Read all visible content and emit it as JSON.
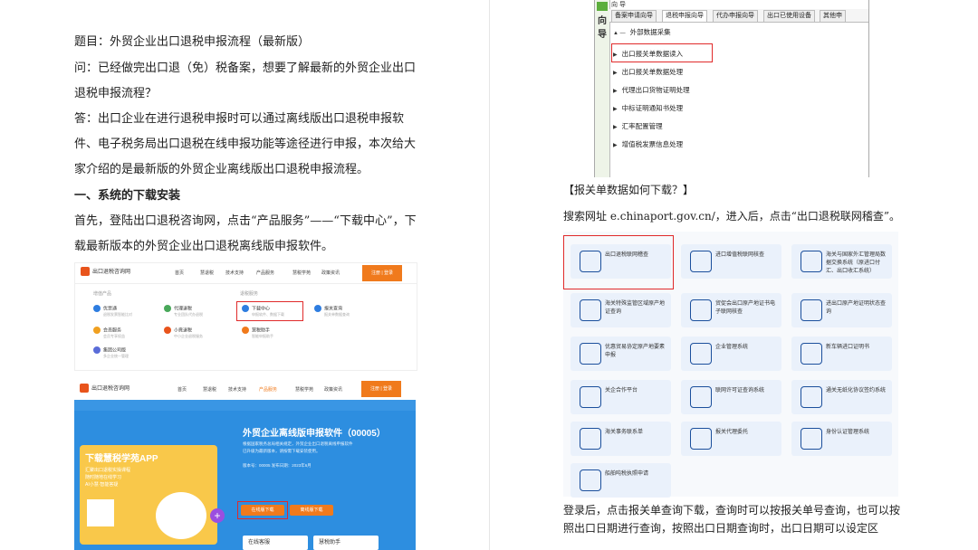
{
  "left": {
    "title": "题目：外贸企业出口退税申报流程（最新版）",
    "question": "问：已经做完出口退（免）税备案，想要了解最新的外贸企业出口退税申报流程？",
    "answer": "答：出口企业在进行退税申报时可以通过离线版出口退税申报软件、电子税务局出口退税在线申报功能等途径进行申报，本次给大家介绍的是最新版的外贸企业离线版出口退税申报流程。",
    "section_heading": "一、系统的下载安装",
    "install_text": "首先，登陆出口退税咨询网，点击“产品服务”——“下载中心”，下载最新版本的外贸企业出口退税离线版申报软件。",
    "site": {
      "logo": "出口退税咨询网",
      "nav": [
        "首页",
        "慧退税",
        "技术支持",
        "产品服务",
        "慧税学苑",
        "政策资讯"
      ],
      "nav_button": "注册 | 登录",
      "groups": [
        "增值产品",
        "退税服务"
      ],
      "items": [
        {
          "label": "优票通",
          "sub": "退税发票智能比对"
        },
        {
          "label": "代理退税",
          "sub": "专业团队代办退税"
        },
        {
          "label": "下载中心",
          "sub": "申报软件、数据下载"
        },
        {
          "label": "报关查询",
          "sub": "报关单数据查询"
        },
        {
          "label": "会员服务",
          "sub": "会员专享权益"
        },
        {
          "label": "小竟退税",
          "sub": "中小企业退税服务"
        },
        {
          "label": "慧税助手",
          "sub": "智能申报助手"
        },
        {
          "label": "集团公司版",
          "sub": "多企业统一管理"
        }
      ],
      "download_page": {
        "software_title": "外贸企业离线版申报软件（00005）",
        "desc_line1": "根据国家税务总局相关规定，外贸企业出口退税离线申报软件",
        "desc_line2": "已升级为最新版本，请按需下载安装使用。",
        "version": "版本号：00005    发布日期：2023年6月",
        "btn_online": "在线版下载",
        "btn_offline": "离线版下载",
        "promo_title": "下载慧税学苑APP",
        "promo_lines": [
          "汇聚出口退税实操课程",
          "随时随地在线学习",
          "AI小慧·智能答疑"
        ],
        "cards": [
          "在线客服",
          "慧税助手"
        ]
      }
    }
  },
  "right": {
    "software": {
      "vtab": [
        "向",
        "导"
      ],
      "top_label": "向 导",
      "tabs": [
        "备案申请向导",
        "退税申报向导",
        "代办申报向导",
        "出口已使用设备",
        "其他申"
      ],
      "tree_root": "外部数据采集",
      "tree_items": [
        "出口报关单数据读入",
        "出口报关单数据处理",
        "代理出口货物证明处理",
        "中标证明通知书处理",
        "汇率配置管理",
        "增值税发票信息处理"
      ]
    },
    "caption": "【报关单数据如何下载？】",
    "search_text": "搜索网址 e.chinaport.gov.cn/，进入后，点击“出口退税联网稽查”。",
    "tiles": [
      "出口退税联网稽查",
      "进口增值税联网核查",
      "海关与国家外汇管理局数据交换系统（原进口付汇、出口收汇系统）",
      "海关特殊监管区域原产地证查询",
      "贸促会出口原产地证书电子联网核查",
      "进出口原产地证明状态查询",
      "优惠贸易协定原产地要素申报",
      "企业管理系统",
      "新车辆进口证明书",
      "关企合作平台",
      "联网许可证查询系统",
      "通关无纸化协议签约系统",
      "海关事务联系单",
      "报关代理委托",
      "身份认证管理系统",
      "船舶吨税执照申请"
    ],
    "after_text": "登录后，点击报关单查询下载，查询时可以按报关单号查询，也可以按照出口日期进行查询，按照出口日期查询时，出口日期可以设定区"
  }
}
